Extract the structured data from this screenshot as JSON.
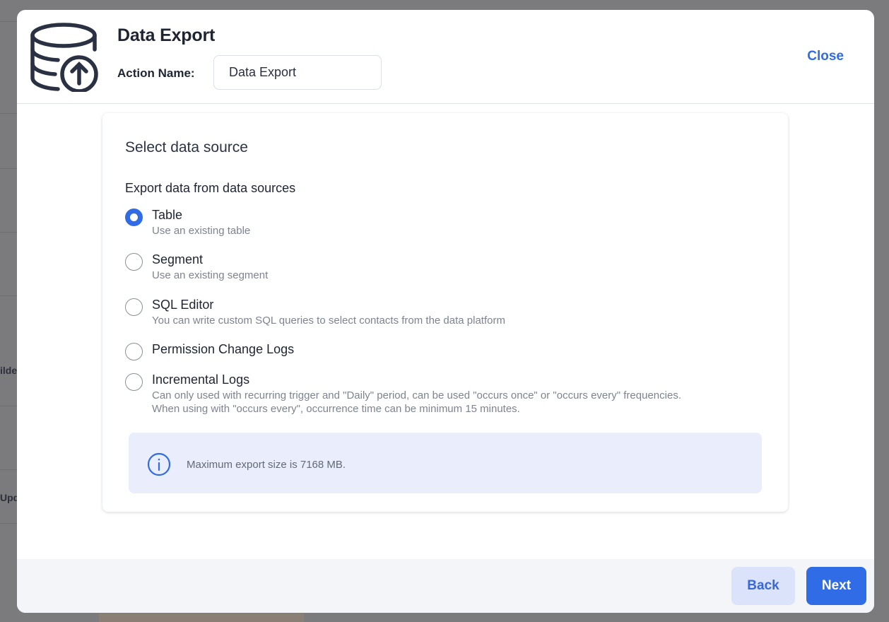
{
  "background": {
    "fragments": [
      "ilde",
      "Upd"
    ]
  },
  "modal": {
    "title": "Data Export",
    "action_name_label": "Action Name:",
    "action_name_value": "Data Export",
    "close_label": "Close",
    "header_icon": "database-upload-icon"
  },
  "card": {
    "title": "Select data source",
    "group_label": "Export data from data sources",
    "options": [
      {
        "label": "Table",
        "desc": "Use an existing table",
        "checked": true
      },
      {
        "label": "Segment",
        "desc": "Use an existing segment",
        "checked": false
      },
      {
        "label": "SQL Editor",
        "desc": "You can write custom SQL queries to select contacts from the data platform",
        "checked": false
      },
      {
        "label": "Permission Change Logs",
        "desc": "",
        "checked": false
      },
      {
        "label": "Incremental Logs",
        "desc_line1": "Can only used with recurring trigger and \"Daily\" period, can be used \"occurs once\" or \"occurs every\" frequencies.",
        "desc_line2": "When using with \"occurs every\", occurrence time can be minimum 15 minutes.",
        "checked": false
      }
    ],
    "info": {
      "icon": "info-icon",
      "text": "Maximum export size is 7168 MB."
    }
  },
  "footer": {
    "back_label": "Back",
    "next_label": "Next"
  },
  "colors": {
    "accent": "#2f6ce5",
    "info_bg": "#eaeefc",
    "back_bg": "#dbe3fb"
  }
}
